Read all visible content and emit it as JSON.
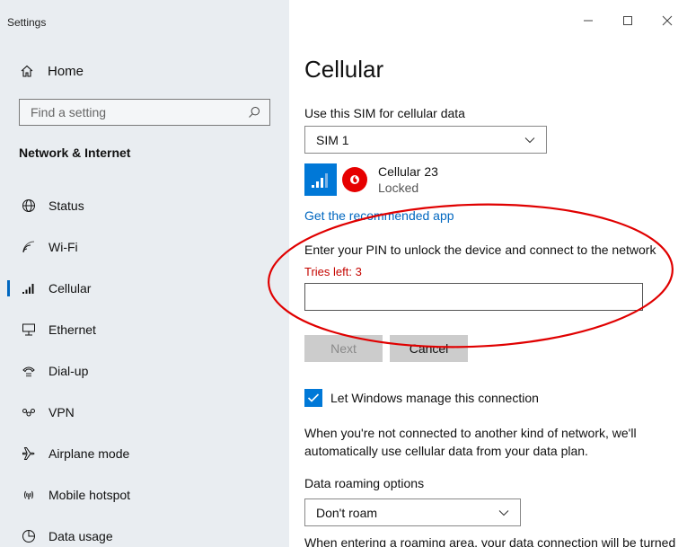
{
  "window": {
    "title": "Settings"
  },
  "sidebar": {
    "home_label": "Home",
    "search_placeholder": "Find a setting",
    "section_title": "Network & Internet",
    "items": [
      {
        "label": "Status",
        "icon": "globe-icon"
      },
      {
        "label": "Wi-Fi",
        "icon": "wifi-icon"
      },
      {
        "label": "Cellular",
        "icon": "cellular-signal-icon",
        "active": true
      },
      {
        "label": "Ethernet",
        "icon": "ethernet-icon"
      },
      {
        "label": "Dial-up",
        "icon": "dial-up-icon"
      },
      {
        "label": "VPN",
        "icon": "vpn-icon"
      },
      {
        "label": "Airplane mode",
        "icon": "airplane-icon"
      },
      {
        "label": "Mobile hotspot",
        "icon": "hotspot-icon"
      },
      {
        "label": "Data usage",
        "icon": "data-usage-icon"
      }
    ]
  },
  "main": {
    "title": "Cellular",
    "sim_label": "Use this SIM for cellular data",
    "sim_selected": "SIM 1",
    "carrier": {
      "name": "Cellular 23",
      "status": "Locked"
    },
    "recommended_link": "Get the recommended app",
    "pin_prompt": "Enter your PIN to unlock the device and connect to the network",
    "tries_left": "Tries left: 3",
    "pin_value": "",
    "next_label": "Next",
    "cancel_label": "Cancel",
    "manage_checkbox_label": "Let Windows manage this connection",
    "manage_checked": true,
    "manage_description": "When you're not connected to another kind of network, we'll automatically use cellular data from your data plan.",
    "roaming_label": "Data roaming options",
    "roaming_selected": "Don't roam",
    "roaming_description": "When entering a roaming area, your data connection will be turned"
  },
  "colors": {
    "accent": "#0078d7",
    "link": "#0067c0",
    "error": "#c50500",
    "annotation": "#e00000",
    "sidebar_bg": "#e9edf1"
  }
}
